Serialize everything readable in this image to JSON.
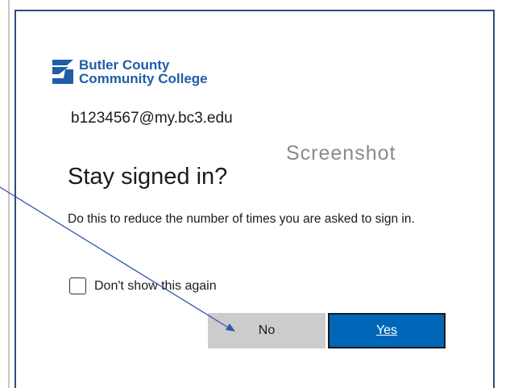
{
  "logo": {
    "line1": "Butler County",
    "line2": "Community College",
    "mark_icon": "bc3-logo-icon",
    "color": "#1f5da8"
  },
  "account": "b1234567@my.bc3.edu",
  "watermark": "Screenshot",
  "title": "Stay signed in?",
  "description": "Do this to reduce the number of times you are asked to sign in.",
  "checkbox": {
    "label": "Don't show this again",
    "checked": false
  },
  "buttons": {
    "no": "No",
    "yes": "Yes"
  },
  "colors": {
    "primary": "#0067b8",
    "secondary_button": "#cccccc",
    "frame": "#2c4f7c",
    "annotation_arrow": "#3557a8"
  }
}
